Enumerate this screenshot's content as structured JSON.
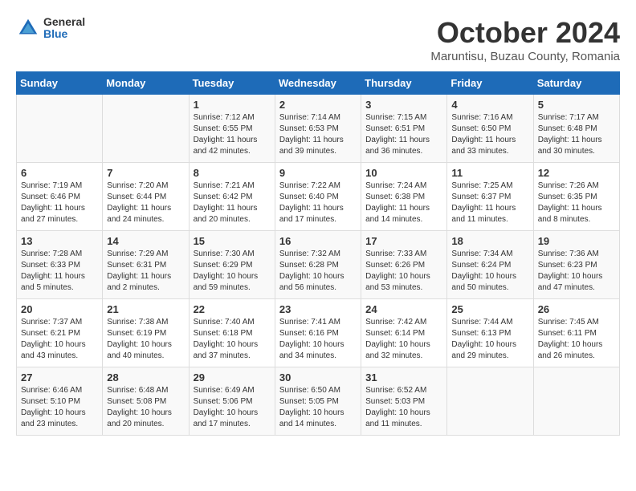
{
  "header": {
    "logo_general": "General",
    "logo_blue": "Blue",
    "month_title": "October 2024",
    "subtitle": "Maruntisu, Buzau County, Romania"
  },
  "days_of_week": [
    "Sunday",
    "Monday",
    "Tuesday",
    "Wednesday",
    "Thursday",
    "Friday",
    "Saturday"
  ],
  "weeks": [
    [
      {
        "day": "",
        "info": ""
      },
      {
        "day": "",
        "info": ""
      },
      {
        "day": "1",
        "info": "Sunrise: 7:12 AM\nSunset: 6:55 PM\nDaylight: 11 hours and 42 minutes."
      },
      {
        "day": "2",
        "info": "Sunrise: 7:14 AM\nSunset: 6:53 PM\nDaylight: 11 hours and 39 minutes."
      },
      {
        "day": "3",
        "info": "Sunrise: 7:15 AM\nSunset: 6:51 PM\nDaylight: 11 hours and 36 minutes."
      },
      {
        "day": "4",
        "info": "Sunrise: 7:16 AM\nSunset: 6:50 PM\nDaylight: 11 hours and 33 minutes."
      },
      {
        "day": "5",
        "info": "Sunrise: 7:17 AM\nSunset: 6:48 PM\nDaylight: 11 hours and 30 minutes."
      }
    ],
    [
      {
        "day": "6",
        "info": "Sunrise: 7:19 AM\nSunset: 6:46 PM\nDaylight: 11 hours and 27 minutes."
      },
      {
        "day": "7",
        "info": "Sunrise: 7:20 AM\nSunset: 6:44 PM\nDaylight: 11 hours and 24 minutes."
      },
      {
        "day": "8",
        "info": "Sunrise: 7:21 AM\nSunset: 6:42 PM\nDaylight: 11 hours and 20 minutes."
      },
      {
        "day": "9",
        "info": "Sunrise: 7:22 AM\nSunset: 6:40 PM\nDaylight: 11 hours and 17 minutes."
      },
      {
        "day": "10",
        "info": "Sunrise: 7:24 AM\nSunset: 6:38 PM\nDaylight: 11 hours and 14 minutes."
      },
      {
        "day": "11",
        "info": "Sunrise: 7:25 AM\nSunset: 6:37 PM\nDaylight: 11 hours and 11 minutes."
      },
      {
        "day": "12",
        "info": "Sunrise: 7:26 AM\nSunset: 6:35 PM\nDaylight: 11 hours and 8 minutes."
      }
    ],
    [
      {
        "day": "13",
        "info": "Sunrise: 7:28 AM\nSunset: 6:33 PM\nDaylight: 11 hours and 5 minutes."
      },
      {
        "day": "14",
        "info": "Sunrise: 7:29 AM\nSunset: 6:31 PM\nDaylight: 11 hours and 2 minutes."
      },
      {
        "day": "15",
        "info": "Sunrise: 7:30 AM\nSunset: 6:29 PM\nDaylight: 10 hours and 59 minutes."
      },
      {
        "day": "16",
        "info": "Sunrise: 7:32 AM\nSunset: 6:28 PM\nDaylight: 10 hours and 56 minutes."
      },
      {
        "day": "17",
        "info": "Sunrise: 7:33 AM\nSunset: 6:26 PM\nDaylight: 10 hours and 53 minutes."
      },
      {
        "day": "18",
        "info": "Sunrise: 7:34 AM\nSunset: 6:24 PM\nDaylight: 10 hours and 50 minutes."
      },
      {
        "day": "19",
        "info": "Sunrise: 7:36 AM\nSunset: 6:23 PM\nDaylight: 10 hours and 47 minutes."
      }
    ],
    [
      {
        "day": "20",
        "info": "Sunrise: 7:37 AM\nSunset: 6:21 PM\nDaylight: 10 hours and 43 minutes."
      },
      {
        "day": "21",
        "info": "Sunrise: 7:38 AM\nSunset: 6:19 PM\nDaylight: 10 hours and 40 minutes."
      },
      {
        "day": "22",
        "info": "Sunrise: 7:40 AM\nSunset: 6:18 PM\nDaylight: 10 hours and 37 minutes."
      },
      {
        "day": "23",
        "info": "Sunrise: 7:41 AM\nSunset: 6:16 PM\nDaylight: 10 hours and 34 minutes."
      },
      {
        "day": "24",
        "info": "Sunrise: 7:42 AM\nSunset: 6:14 PM\nDaylight: 10 hours and 32 minutes."
      },
      {
        "day": "25",
        "info": "Sunrise: 7:44 AM\nSunset: 6:13 PM\nDaylight: 10 hours and 29 minutes."
      },
      {
        "day": "26",
        "info": "Sunrise: 7:45 AM\nSunset: 6:11 PM\nDaylight: 10 hours and 26 minutes."
      }
    ],
    [
      {
        "day": "27",
        "info": "Sunrise: 6:46 AM\nSunset: 5:10 PM\nDaylight: 10 hours and 23 minutes."
      },
      {
        "day": "28",
        "info": "Sunrise: 6:48 AM\nSunset: 5:08 PM\nDaylight: 10 hours and 20 minutes."
      },
      {
        "day": "29",
        "info": "Sunrise: 6:49 AM\nSunset: 5:06 PM\nDaylight: 10 hours and 17 minutes."
      },
      {
        "day": "30",
        "info": "Sunrise: 6:50 AM\nSunset: 5:05 PM\nDaylight: 10 hours and 14 minutes."
      },
      {
        "day": "31",
        "info": "Sunrise: 6:52 AM\nSunset: 5:03 PM\nDaylight: 10 hours and 11 minutes."
      },
      {
        "day": "",
        "info": ""
      },
      {
        "day": "",
        "info": ""
      }
    ]
  ]
}
